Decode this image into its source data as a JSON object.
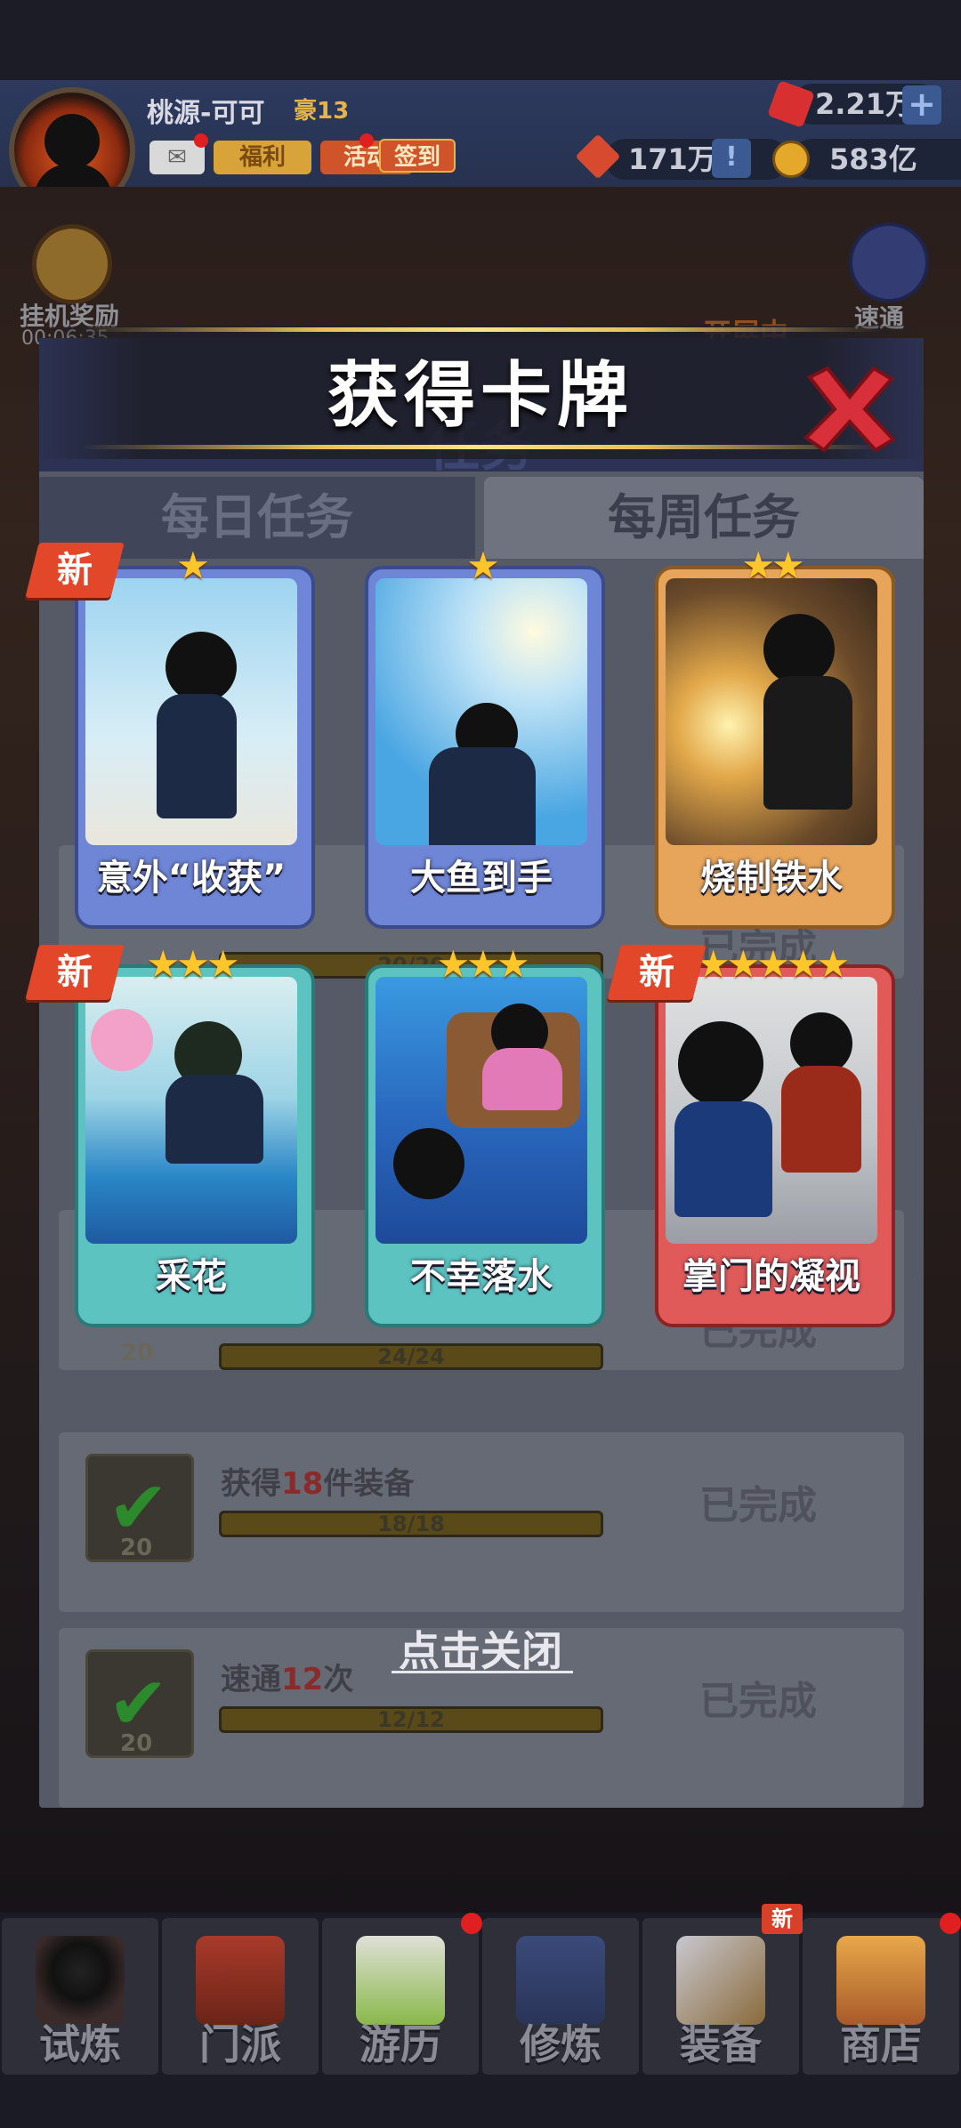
{
  "player": {
    "name": "桃源-可可",
    "vip": "豪13"
  },
  "header_buttons": {
    "bonus": "福利",
    "activity": "活动",
    "checkin": "签到"
  },
  "currency": {
    "gems": "2.21万",
    "tokens": "171万",
    "gold": "583亿"
  },
  "side": {
    "idle_reward": "挂机奖励",
    "idle_timer": "00:06:35",
    "quick_pass": "速通"
  },
  "scene_labels": {
    "ongoing": "开展中",
    "quest_title": "任务"
  },
  "tabs": {
    "daily": "每日任务",
    "weekly": "每周任务"
  },
  "tasks": [
    {
      "title_pre": "获得",
      "title_hl": "18",
      "title_post": "件装备",
      "reward": "20",
      "progress": "18/18",
      "status": "已完成"
    },
    {
      "title_pre": "速通",
      "title_hl": "12",
      "title_post": "次",
      "reward": "20",
      "progress": "12/12",
      "status": "已完成"
    }
  ],
  "partial_tasks": [
    {
      "status": "已完成",
      "progress": "20/20"
    },
    {
      "status": "已完成",
      "progress": "24/24",
      "reward": "20"
    }
  ],
  "modal": {
    "title": "获得卡牌",
    "close_hint": "点击关闭",
    "new_tag": "新"
  },
  "cards": [
    {
      "name": "意外“收获”",
      "stars": 1,
      "stars_text": "★",
      "is_new": true,
      "frame_color": "#6f86d6"
    },
    {
      "name": "大鱼到手",
      "stars": 1,
      "stars_text": "★",
      "is_new": false,
      "frame_color": "#6f86d6"
    },
    {
      "name": "烧制铁水",
      "stars": 2,
      "stars_text": "★★",
      "is_new": false,
      "frame_color": "#e7a55c"
    },
    {
      "name": "采花",
      "stars": 3,
      "stars_text": "★★★",
      "is_new": true,
      "frame_color": "#5cc3c0"
    },
    {
      "name": "不幸落水",
      "stars": 3,
      "stars_text": "★★★",
      "is_new": false,
      "frame_color": "#5cc3c0"
    },
    {
      "name": "掌门的凝视",
      "stars": 5,
      "stars_text": "★★★★★",
      "is_new": true,
      "frame_color": "#e05a5a"
    }
  ],
  "nav": [
    {
      "label": "试炼",
      "icon": "ninja-icon"
    },
    {
      "label": "门派",
      "icon": "temple-icon"
    },
    {
      "label": "游历",
      "icon": "cloud-icon"
    },
    {
      "label": "修炼",
      "icon": "scroll-icon"
    },
    {
      "label": "装备",
      "icon": "sword-icon",
      "badge": "新"
    },
    {
      "label": "商店",
      "icon": "shop-icon"
    }
  ],
  "colors": {
    "accent_gold": "#ffc62b",
    "new_tag": "#e3472a",
    "panel": "#565a66"
  }
}
